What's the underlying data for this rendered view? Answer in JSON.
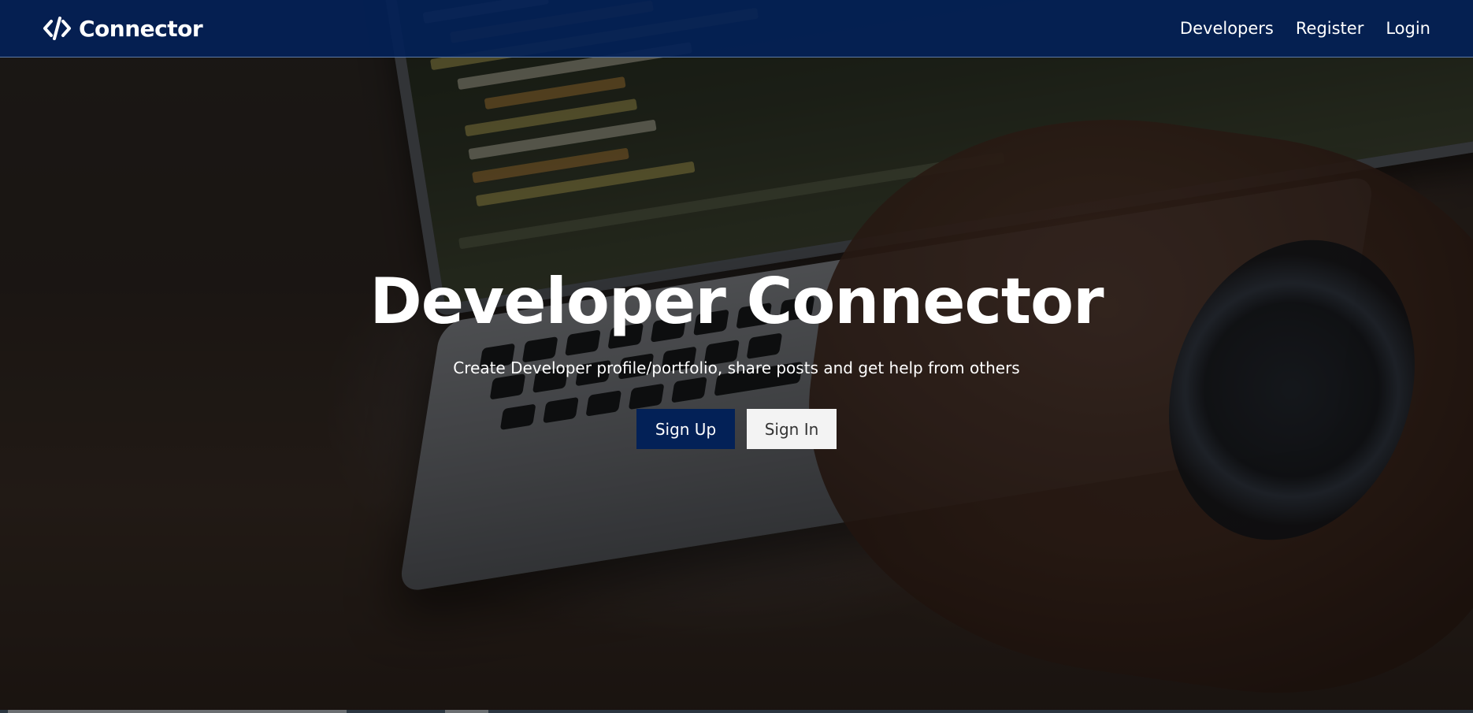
{
  "navbar": {
    "brand": "Connector",
    "brand_icon": "code-icon",
    "links": [
      {
        "label": "Developers"
      },
      {
        "label": "Register"
      },
      {
        "label": "Login"
      }
    ]
  },
  "hero": {
    "title": "Developer Connector",
    "subtitle": "Create Developer profile/portfolio, share posts and get help from others",
    "signup_label": "Sign Up",
    "signin_label": "Sign In"
  },
  "colors": {
    "navbar": "#032157",
    "primary_button": "#032157",
    "light_button": "#f3f3f3",
    "text": "#ffffff"
  }
}
